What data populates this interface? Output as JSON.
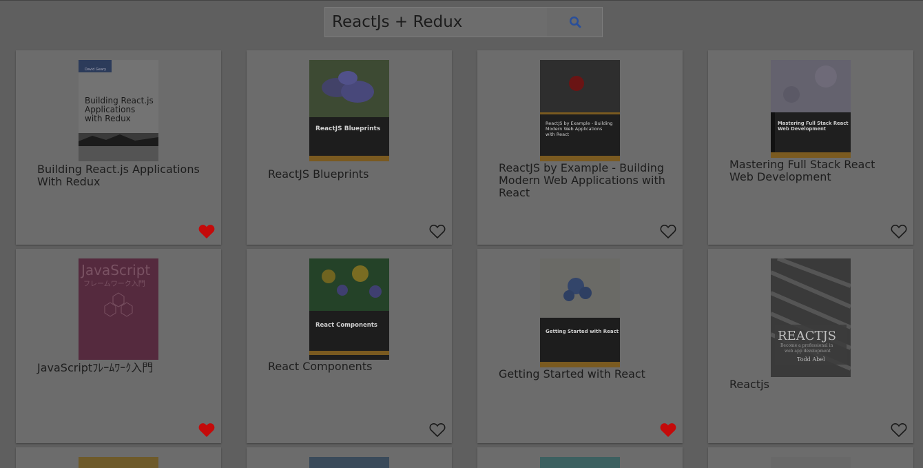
{
  "search": {
    "value": "ReactJs + Redux"
  },
  "books": [
    {
      "title": "Building React.js Applications With Redux",
      "favorite": true,
      "cover": {
        "author": "David Geary",
        "line1": "Building React.js",
        "line2": "Applications",
        "line3": "with Redux"
      }
    },
    {
      "title": "ReactJS Blueprints",
      "favorite": false,
      "cover": {
        "heading": "ReactJS Blueprints"
      }
    },
    {
      "title": "ReactJS by Example - Building Modern Web Applications with React",
      "favorite": false,
      "cover": {
        "line1": "ReactJS by Example - Building",
        "line2": "Modern Web Applications",
        "line3": "with React"
      }
    },
    {
      "title": "Mastering Full Stack React Web Development",
      "favorite": false,
      "cover": {
        "line1": "Mastering Full Stack React",
        "line2": "Web Development"
      }
    },
    {
      "title": "JavaScriptﾌﾚｰﾑﾜｰｸ入門",
      "favorite": true,
      "cover": {
        "line1": "JavaScript",
        "line2": "フレームワーク入門"
      }
    },
    {
      "title": "React Components",
      "favorite": false,
      "cover": {
        "heading": "React Components"
      }
    },
    {
      "title": "Getting Started with React",
      "favorite": true,
      "cover": {
        "heading": "Getting Started with React"
      }
    },
    {
      "title": "Reactjs",
      "favorite": false,
      "cover": {
        "line1": "REACTJS",
        "line2": "Become a professional in",
        "line3": "web app development",
        "author": "Todd Abel"
      }
    }
  ],
  "colors": {
    "favorite_on": "#c40a0a",
    "heart_outline": "#1a1a1a",
    "search_icon": "#2a4f9a"
  }
}
